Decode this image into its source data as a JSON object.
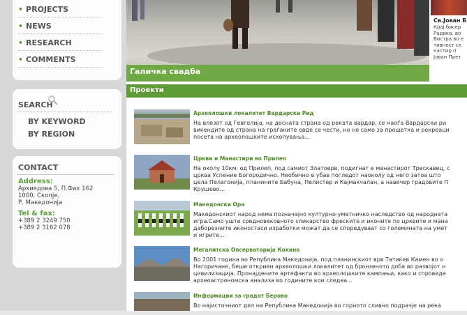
{
  "nav": {
    "items": [
      {
        "label": "PROJECTS"
      },
      {
        "label": "NEWS"
      },
      {
        "label": "RESEARCH"
      },
      {
        "label": "COMMENTS"
      }
    ]
  },
  "search": {
    "title": "SEARCH",
    "by_keyword": "BY KEYWORD",
    "by_region": "BY REGION"
  },
  "contact": {
    "title": "CONTACT",
    "address_label": "Address:",
    "address_line1": "Архиедова 5, П.Фах 162",
    "address_line2": "1000, Скопје,",
    "address_line3": "Р. Македонија",
    "tel_label": "Tel & fax:",
    "tel1": "+389 2 3249 750",
    "tel2": "+389 2 3162 078"
  },
  "hero": {
    "caption": "Галичка свадба"
  },
  "side_card": {
    "title": "Св.Јован Б",
    "text": "Крај бисер\nРадика. во\nВистра во е\nтивност се \nнастир п\nЈован Прет"
  },
  "section": {
    "title": "Проекти"
  },
  "items": [
    {
      "title": "Археолошки локалитет Вардарски Рид",
      "desc": "На влезот од Гевгелија, на десната страна од реката вардар, се наоѓа Вардарски ри\nвикендите од страна на граѓаните овде се чести, но не само за прошетка и рекреаци\nпосета на археолошките ископувања..."
    },
    {
      "title": "Цркви и Манастири во Прилеп",
      "desc": "На околу 10км. од Прилеп, под самиот Златоврв, подигнат е манастирот Трескавец, с\nцрква Успение Богородично. Необично е убав погледот наоколу од него затоа што\nцела Пелагонија, планините Бабуна, Пелистер и Кајмакчалан, а навечер градовите П\nКрушево..."
    },
    {
      "title": "Македонски Ора",
      "desc": "Македонскиот народ нема позначајно културно-уметничко наследство од народната\nигра.Само уште средновековното сликарство фреските и иконите по црквите и мана\nдаборезните иконостаси изработки можат да се споредуваат со големината на умет\nи игрите..."
    },
    {
      "title": "Мегалитска Опсерваторија Кокино",
      "desc": "Во 2001 година во Република Македонија, под планинскиот врв Татиќев Камен во о\nНагоричане, беше откриен археолошки локалитет од бронзеното доба во развојот н\nцивилизација. Пронајдените артефакти во археолошките кампањи, како и спроведе\nархеоастрономска анализа во годините кои следеа..."
    },
    {
      "title": "Информации за градот Берово",
      "desc": "Во најисточниот дел на Република Македонија во горното сливно подрачје на река"
    }
  ]
}
